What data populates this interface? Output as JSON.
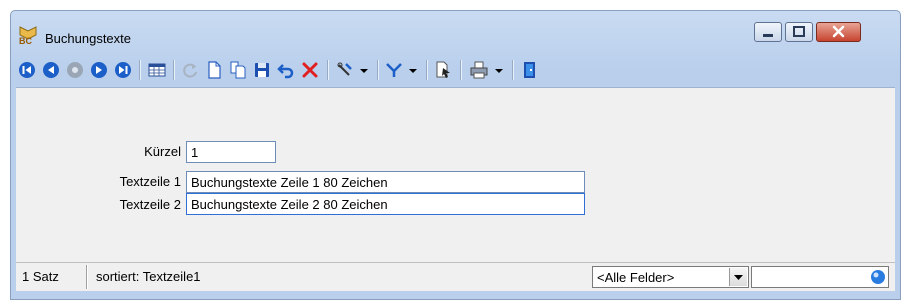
{
  "window": {
    "title": "Buchungstexte",
    "app_icon_text": "BC"
  },
  "toolbar": {
    "buttons": [
      {
        "name": "first-record-icon"
      },
      {
        "name": "previous-record-icon"
      },
      {
        "name": "record-disabled-icon"
      },
      {
        "name": "next-record-icon"
      },
      {
        "name": "last-record-icon"
      },
      {
        "name": "table-view-icon"
      },
      {
        "name": "refresh-icon"
      },
      {
        "name": "new-document-icon"
      },
      {
        "name": "copy-icon"
      },
      {
        "name": "save-icon"
      },
      {
        "name": "undo-icon"
      },
      {
        "name": "delete-icon"
      },
      {
        "name": "tools-icon"
      },
      {
        "name": "filter-icon"
      },
      {
        "name": "document-select-icon"
      },
      {
        "name": "print-icon"
      },
      {
        "name": "exit-icon"
      }
    ]
  },
  "form": {
    "kuerzel_label": "Kürzel",
    "kuerzel_value": "1",
    "textzeile1_label": "Textzeile 1",
    "textzeile1_value": "Buchungstexte Zeile 1 80 Zeichen",
    "textzeile2_label": "Textzeile 2",
    "textzeile2_value": "Buchungstexte Zeile 2 80 Zeichen"
  },
  "statusbar": {
    "record_count": "1 Satz",
    "sort_text": "sortiert: Textzeile1",
    "field_filter_value": "<Alle Felder>",
    "search_value": ""
  },
  "colors": {
    "accent_blue": "#1d5fc8",
    "delete_red": "#e02020",
    "title_gradient_top": "#c9dbf2"
  }
}
